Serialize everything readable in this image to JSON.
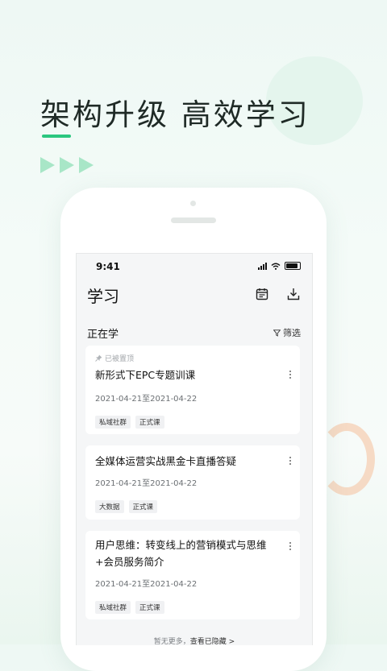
{
  "hero": {
    "title": "架构升级  高效学习"
  },
  "status_bar": {
    "time": "9:41"
  },
  "header": {
    "title": "学习"
  },
  "section": {
    "title": "正在学",
    "filter_label": "筛选"
  },
  "cards": [
    {
      "pinned_label": "已被置顶",
      "title": "新形式下EPC专题训课",
      "date": "2021-04-21至2021-04-22",
      "tags": [
        "私域社群",
        "正式课"
      ]
    },
    {
      "title": "全媒体运营实战黑金卡直播答疑",
      "date": "2021-04-21至2021-04-22",
      "tags": [
        "大数据",
        "正式课"
      ]
    },
    {
      "title": "用户思维：转变线上的营销模式与思维+会员服务简介",
      "date": "2021-04-21至2021-04-22",
      "tags": [
        "私域社群",
        "正式课"
      ]
    }
  ],
  "footer": {
    "text": "暂无更多，",
    "link": "查看已隐藏 >"
  },
  "icons": {
    "calendar": "calendar-icon",
    "download": "download-icon",
    "filter": "filter-icon",
    "pin": "pin-icon",
    "more": "more-vertical-icon"
  },
  "colors": {
    "accent": "#2bc77f",
    "arrow": "#a8e6c7"
  }
}
